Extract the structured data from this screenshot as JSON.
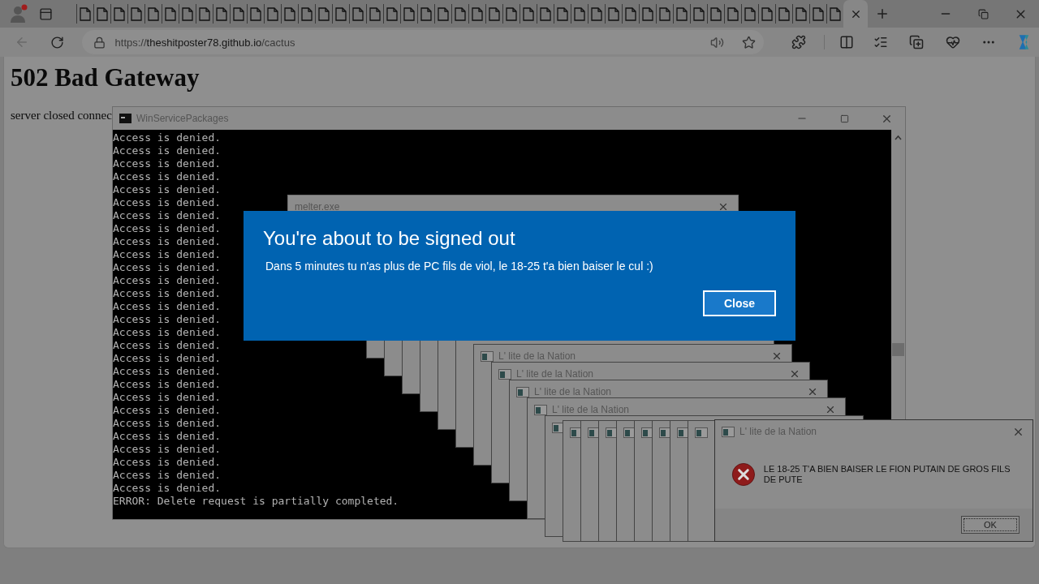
{
  "browser": {
    "tabs": [
      {
        "selected": false
      },
      {
        "selected": false
      },
      {
        "selected": false
      },
      {
        "selected": false
      },
      {
        "selected": false
      },
      {
        "selected": false
      },
      {
        "selected": false
      },
      {
        "selected": false
      },
      {
        "selected": false
      },
      {
        "selected": false
      },
      {
        "selected": false
      },
      {
        "selected": false
      },
      {
        "selected": false
      },
      {
        "selected": false
      },
      {
        "selected": false
      },
      {
        "selected": false
      },
      {
        "selected": false
      },
      {
        "selected": false
      },
      {
        "selected": false
      },
      {
        "selected": false
      },
      {
        "selected": false
      },
      {
        "selected": false
      },
      {
        "selected": false
      },
      {
        "selected": false
      },
      {
        "selected": false
      },
      {
        "selected": false
      },
      {
        "selected": false
      },
      {
        "selected": false
      },
      {
        "selected": false
      },
      {
        "selected": false
      },
      {
        "selected": false
      },
      {
        "selected": false
      },
      {
        "selected": false
      },
      {
        "selected": false
      },
      {
        "selected": false
      },
      {
        "selected": false
      },
      {
        "selected": false
      },
      {
        "selected": false
      },
      {
        "selected": false
      },
      {
        "selected": false
      },
      {
        "selected": false
      },
      {
        "selected": false
      },
      {
        "selected": false
      },
      {
        "selected": false
      },
      {
        "selected": false
      },
      {
        "selected": true
      }
    ],
    "url_scheme": "https://",
    "url_host": "theshitposter78.github.io",
    "url_path": "/cactus"
  },
  "page": {
    "heading": "502 Bad Gateway",
    "text": "server closed connec"
  },
  "console_window": {
    "title": "WinServicePackages",
    "lines": [
      "Access is denied.",
      "Access is denied.",
      "Access is denied.",
      "Access is denied.",
      "Access is denied.",
      "Access is denied.",
      "Access is denied.",
      "Access is denied.",
      "Access is denied.",
      "Access is denied.",
      "Access is denied.",
      "Access is denied.",
      "Access is denied.",
      "Access is denied.",
      "Access is denied.",
      "Access is denied.",
      "Access is denied.",
      "Access is denied.",
      "Access is denied.",
      "Access is denied.",
      "Access is denied.",
      "Access is denied.",
      "Access is denied.",
      "Access is denied.",
      "Access is denied.",
      "Access is denied.",
      "Access is denied.",
      "Access is denied.",
      "ERROR: Delete request is partially completed."
    ]
  },
  "melter_window": {
    "title": "melter.exe"
  },
  "cascade": [
    {
      "kind": "covered"
    },
    {
      "kind": "covered"
    },
    {
      "kind": "covered"
    },
    {
      "kind": "covered"
    },
    {
      "kind": "covered"
    },
    {
      "kind": "covered"
    },
    {
      "kind": "titled",
      "title": "L' lite de la Nation"
    },
    {
      "kind": "titled",
      "title": "L' lite de la Nation"
    },
    {
      "kind": "titled",
      "title": "L' lite de la Nation"
    },
    {
      "kind": "titled",
      "title": "L' lite de la Nation"
    },
    {
      "kind": "icon_only"
    },
    {
      "kind": "icon_only"
    },
    {
      "kind": "icon_only"
    },
    {
      "kind": "icon_only"
    },
    {
      "kind": "icon_only"
    },
    {
      "kind": "icon_only"
    },
    {
      "kind": "icon_only"
    },
    {
      "kind": "icon_only"
    },
    {
      "kind": "icon_only"
    }
  ],
  "error_dialog": {
    "title": "L' lite de la Nation",
    "message": "LE 18-25 T'A BIEN BAISER LE FION PUTAIN DE GROS FILS DE PUTE",
    "button": "OK"
  },
  "signout_dialog": {
    "title": "You're about to be signed out",
    "message": "Dans 5 minutes tu n'as plus de PC fils de viol, le 18-25 t'a bien baiser le cul :)",
    "button": "Close"
  }
}
